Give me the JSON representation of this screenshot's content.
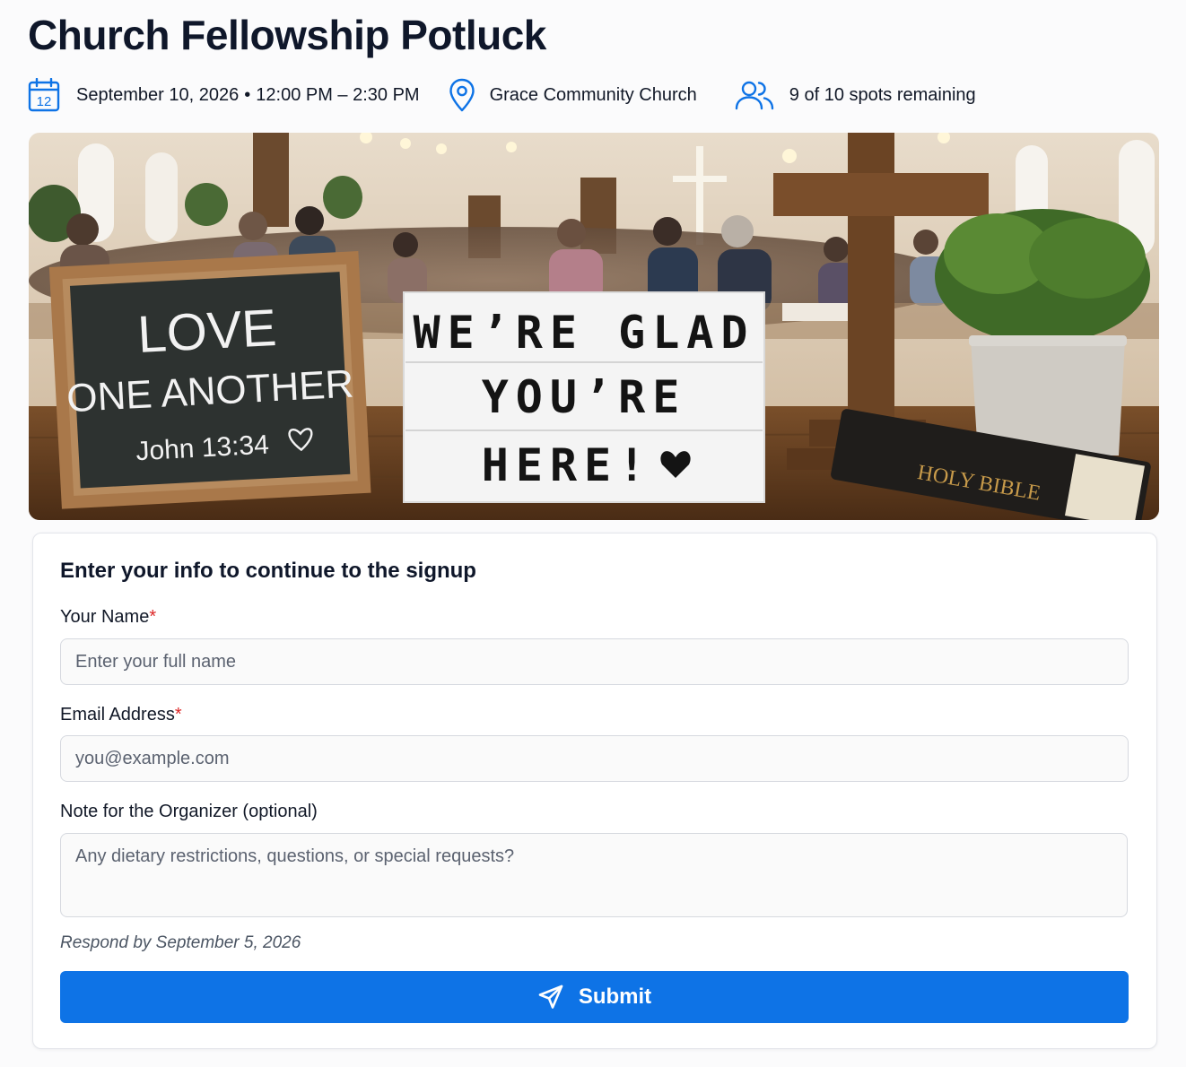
{
  "event": {
    "title": "Church Fellowship Potluck",
    "date": "September 10, 2026",
    "separator": "•",
    "time": "12:00 PM – 2:30 PM",
    "calendar_day": "12",
    "location": "Grace Community Church",
    "spots": "9 of 10 spots remaining"
  },
  "icons": {
    "date": "calendar-icon",
    "location": "map-pin-icon",
    "spots": "users-icon",
    "submit": "send-icon"
  },
  "hero": {
    "chalkboard_lines": [
      "LOVE",
      "ONE ANOTHER",
      "John 13:34"
    ],
    "lightbox_lines": [
      "WE’RE GLAD",
      "YOU’RE",
      "HERE!"
    ],
    "bible_text": "HOLY BIBLE"
  },
  "form": {
    "heading": "Enter your info to continue to the signup",
    "name_label": "Your Name",
    "name_placeholder": "Enter your full name",
    "email_label": "Email Address",
    "email_placeholder": "you@example.com",
    "note_label": "Note for the Organizer (optional)",
    "note_placeholder": "Any dietary restrictions, questions, or special requests?",
    "required_mark": "*",
    "deadline": "Respond by September 5, 2026",
    "submit_label": "Submit"
  },
  "colors": {
    "accent": "#0e73e6",
    "required": "#dc2626",
    "title": "#0f172a"
  }
}
